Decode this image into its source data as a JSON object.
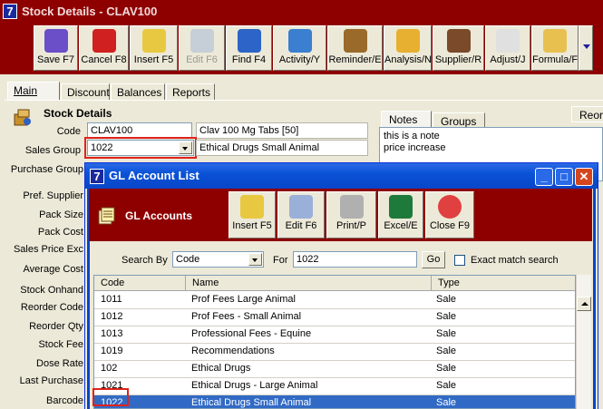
{
  "main_window": {
    "app_icon": "7",
    "title": "Stock Details - CLAV100",
    "toolbar": [
      {
        "label": "Save F7",
        "icon": "save-icon",
        "enabled": true
      },
      {
        "label": "Cancel F8",
        "icon": "cancel-icon",
        "enabled": true
      },
      {
        "label": "Insert F5",
        "icon": "insert-icon",
        "enabled": true
      },
      {
        "label": "Edit F6",
        "icon": "edit-icon",
        "enabled": false
      },
      {
        "label": "Find F4",
        "icon": "find-icon",
        "enabled": true
      },
      {
        "label": "Activity/Y",
        "icon": "activity-icon",
        "enabled": true
      },
      {
        "label": "Reminder/E",
        "icon": "reminder-icon",
        "enabled": true
      },
      {
        "label": "Analysis/N",
        "icon": "analysis-icon",
        "enabled": true
      },
      {
        "label": "Supplier/R",
        "icon": "supplier-icon",
        "enabled": true
      },
      {
        "label": "Adjust/J",
        "icon": "adjust-icon",
        "enabled": true
      },
      {
        "label": "Formula/F",
        "icon": "formula-icon",
        "enabled": true
      }
    ],
    "tabs": [
      "Main",
      "Discount",
      "Balances",
      "Reports"
    ],
    "active_tab": "Main",
    "section_title": "Stock Details",
    "fields": {
      "code_label": "Code",
      "code_value": "CLAV100",
      "description_value": "Clav 100 Mg Tabs [50]",
      "sales_group_label": "Sales Group",
      "sales_group_value": "1022",
      "sales_group_desc": "Ethical Drugs Small Animal",
      "purchase_group_label": "Purchase Group"
    },
    "side_labels": [
      "Pref. Supplier",
      "Pack Size",
      "Pack Cost",
      "Sales Price Exc",
      "Average Cost",
      "Stock Onhand",
      "Reorder Code",
      "Reorder Qty",
      "Stock Fee",
      "Dose Rate",
      "Last Purchase",
      "Barcode"
    ],
    "notes_tabs": [
      "Notes",
      "Groups"
    ],
    "notes_lines": [
      "this is a note",
      "price increase"
    ],
    "reorder_tab": "Reord"
  },
  "dialog": {
    "app_icon": "7",
    "title": "GL Account List",
    "header": "GL Accounts",
    "toolbar": [
      {
        "label": "Insert F5",
        "icon": "insert-icon"
      },
      {
        "label": "Edit F6",
        "icon": "edit-icon"
      },
      {
        "label": "Print/P",
        "icon": "printer-icon"
      },
      {
        "label": "Excel/E",
        "icon": "excel-icon"
      },
      {
        "label": "Close F9",
        "icon": "close-circle-icon"
      }
    ],
    "search": {
      "search_by_label": "Search By",
      "search_by_value": "Code",
      "for_label": "For",
      "for_value": "1022",
      "go_label": "Go",
      "exact_label": "Exact match search",
      "exact_checked": false
    },
    "columns": [
      "Code",
      "Name",
      "Type"
    ],
    "rows": [
      {
        "code": "1011",
        "name": "Prof Fees Large Animal",
        "type": "Sale"
      },
      {
        "code": "1012",
        "name": "Prof  Fees - Small Animal",
        "type": "Sale"
      },
      {
        "code": "1013",
        "name": "Professional Fees - Equine",
        "type": "Sale"
      },
      {
        "code": "1019",
        "name": "Recommendations",
        "type": "Sale"
      },
      {
        "code": "102",
        "name": "Ethical Drugs",
        "type": "Sale"
      },
      {
        "code": "1021",
        "name": "Ethical Drugs - Large Animal",
        "type": "Sale"
      },
      {
        "code": "1022",
        "name": "Ethical Drugs Small Animal",
        "type": "Sale"
      }
    ],
    "selected_code": "1022",
    "colors": {
      "title_bar": "#0a52d7",
      "toolbar_bg": "#8e0000",
      "selection": "#316ac5",
      "highlight_box": "#e0221b"
    }
  }
}
